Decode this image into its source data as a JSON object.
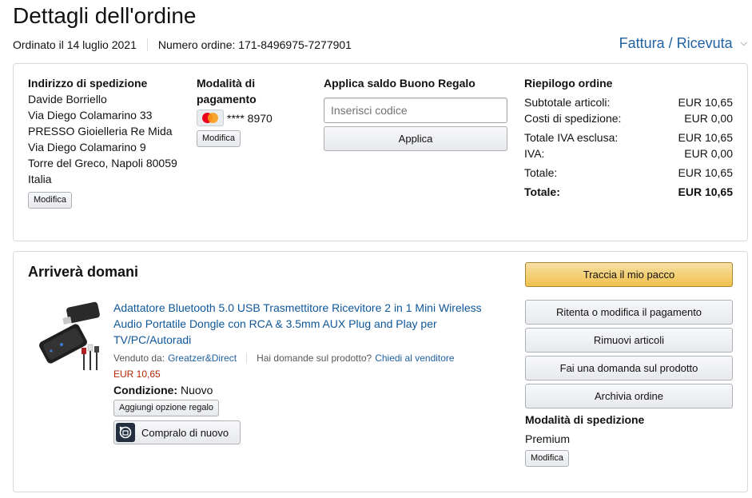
{
  "header": {
    "title": "Dettagli dell'ordine",
    "ordered_on": "Ordinato il 14 luglio 2021",
    "order_number": "Numero ordine: 171-8496975-7277901",
    "invoice_link": "Fattura / Ricevuta"
  },
  "shipping_address": {
    "heading": "Indirizzo di spedizione",
    "lines": [
      "Davide Borriello",
      "Via Diego Colamarino 33",
      "PRESSO Gioielleria Re Mida",
      "Via Diego Colamarino 9",
      "Torre del Greco, Napoli 80059",
      "Italia"
    ],
    "edit_label": "Modifica"
  },
  "payment": {
    "heading": "Modalità di pagamento",
    "card_brand": "MasterCard",
    "card_text": "**** 8970",
    "edit_label": "Modifica"
  },
  "gift_card": {
    "heading": "Applica saldo Buono Regalo",
    "placeholder": "Inserisci codice",
    "apply_label": "Applica"
  },
  "summary": {
    "heading": "Riepilogo ordine",
    "rows": [
      {
        "label": "Subtotale articoli:",
        "value": "EUR 10,65"
      },
      {
        "label": "Costi di spedizione:",
        "value": "EUR 0,00"
      },
      {
        "label": "Totale IVA esclusa:",
        "value": "EUR 10,65"
      },
      {
        "label": "IVA:",
        "value": "EUR 0,00"
      },
      {
        "label": "Totale:",
        "value": "EUR 10,65"
      },
      {
        "label": "Totale:",
        "value": "EUR 10,65"
      }
    ]
  },
  "shipment": {
    "status": "Arriverà domani",
    "product": {
      "title": "Adattatore Bluetooth 5.0 USB Trasmettitore Ricevitore 2 in 1 Mini Wireless Audio Portatile Dongle con RCA & 3.5mm AUX Plug and Play per TV/PC/Autoradi",
      "sold_by_label": "Venduto da:",
      "seller": "Greatzer&Direct",
      "question_label": "Hai domande sul prodotto?",
      "ask_seller": "Chiedi al venditore",
      "price": "EUR 10,65",
      "condition_label": "Condizione:",
      "condition_value": "Nuovo",
      "gift_option_label": "Aggiungi opzione regalo",
      "buy_again_label": "Compralo di nuovo"
    },
    "actions": {
      "track": "Traccia il mio pacco",
      "retry_payment": "Ritenta o modifica il pagamento",
      "remove_items": "Rimuovi articoli",
      "ask_question": "Fai una domanda sul prodotto",
      "archive": "Archivia ordine"
    },
    "shipping_mode": {
      "heading": "Modalità di spedizione",
      "value": "Premium",
      "edit_label": "Modifica"
    }
  },
  "colors": {
    "link": "#2162a1",
    "price": "#b12704",
    "primary_button": "#f0c14b"
  }
}
